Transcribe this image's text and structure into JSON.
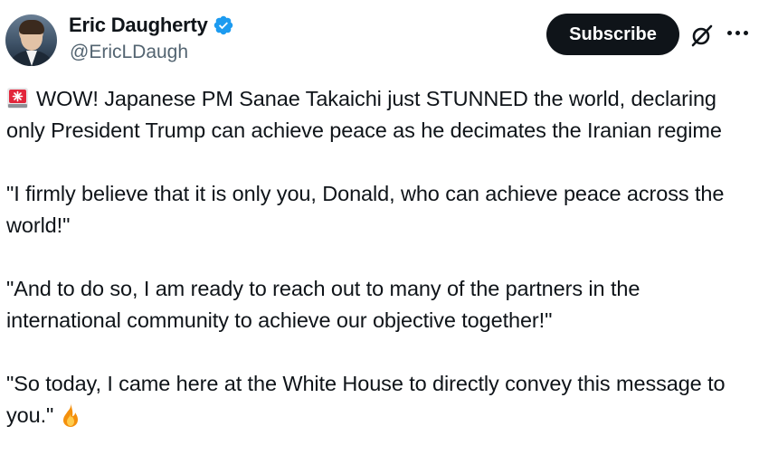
{
  "author": {
    "display_name": "Eric Daugherty",
    "handle": "@EricLDaugh",
    "verified": true,
    "verified_color": "#1d9bf0"
  },
  "actions": {
    "subscribe_label": "Subscribe",
    "grok_icon": "grok-icon",
    "more_icon": "more-icon"
  },
  "post": {
    "p1_icon": "rotating-light-icon",
    "p1_text": "WOW! Japanese PM Sanae Takaichi just STUNNED the world, declaring only President Trump can achieve peace as he decimates the Iranian regime",
    "p2_text": "\"I firmly believe that it is only you, Donald, who can achieve peace across the world!\"",
    "p3_text": "\"And to do so, I am ready to reach out to many of the partners in the international community to achieve our objective together!\"",
    "p4_text": "\"So today, I came here at the White House to directly convey this message to you.\"",
    "p4_icon": "fire-icon"
  }
}
